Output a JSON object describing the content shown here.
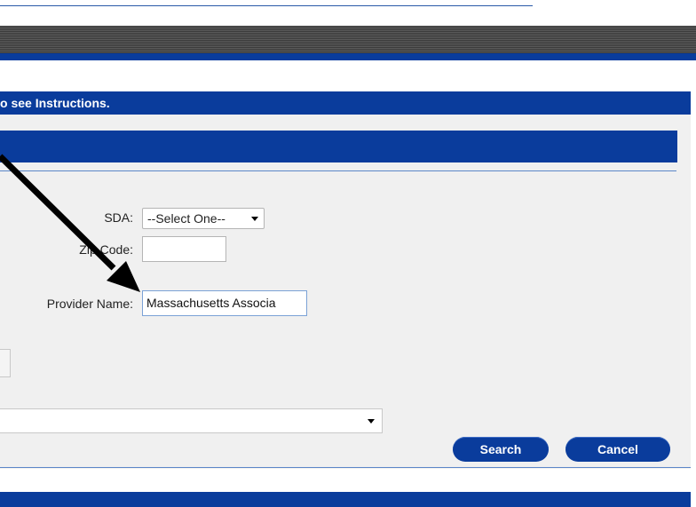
{
  "instructions_bar": {
    "text": "o see Instructions."
  },
  "form": {
    "sda": {
      "label": "SDA:",
      "selected": "--Select One--"
    },
    "zip": {
      "label": "Zip Code:",
      "value": ""
    },
    "provider": {
      "label": "Provider Name:",
      "value": "Massachusetts Associa"
    }
  },
  "actions": {
    "search_label": "Search",
    "cancel_label": "Cancel"
  },
  "colors": {
    "brand_blue": "#0a3c9c",
    "panel_bg": "#f0f0f0"
  },
  "annotation": {
    "icon": "arrow-annotation-icon"
  }
}
